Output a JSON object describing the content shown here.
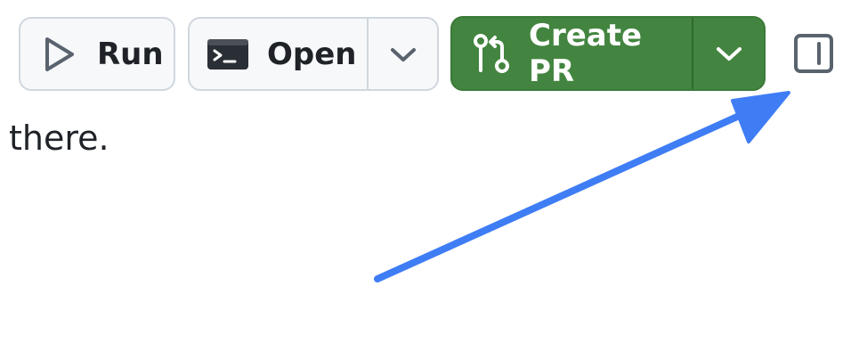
{
  "toolbar": {
    "run_label": "Run",
    "open_label": "Open",
    "create_pr_label": "Create PR"
  },
  "icons": {
    "run": "play-icon",
    "open": "terminal-icon",
    "open_dropdown": "chevron-down-icon",
    "create_pr": "git-pull-request-icon",
    "create_pr_dropdown": "chevron-down-icon",
    "sidebar_toggle": "sidebar-toggle-icon",
    "annotation": "arrow-icon"
  },
  "content": {
    "text": "there."
  },
  "colors": {
    "primary_button": "#438540",
    "annotation_arrow": "#3f7df5",
    "secondary_button_bg": "#f6f8fa",
    "secondary_button_border": "#d0d7de"
  }
}
